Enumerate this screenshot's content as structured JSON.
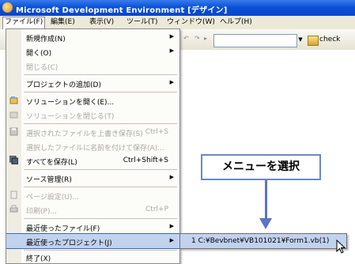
{
  "window": {
    "title": "Microsoft Development Environment [デザイン]"
  },
  "menubar": {
    "items": [
      "ファイル(F)",
      "編集(E)",
      "表示(V)",
      "ツール(T)",
      "ウィンドウ(W)",
      "ヘルプ(H)"
    ]
  },
  "toolbar": {
    "find_text": "check"
  },
  "file_menu": {
    "items": [
      {
        "label": "新規作成(N)",
        "shortcut": "",
        "submenu": true,
        "enabled": true,
        "icon": ""
      },
      {
        "label": "開く(O)",
        "shortcut": "",
        "submenu": true,
        "enabled": true,
        "icon": ""
      },
      {
        "label": "閉じる(C)",
        "shortcut": "",
        "submenu": false,
        "enabled": false,
        "icon": ""
      },
      {
        "label": "プロジェクトの追加(D)",
        "shortcut": "",
        "submenu": true,
        "enabled": true,
        "icon": ""
      },
      {
        "label": "ソリューションを開く(E)...",
        "shortcut": "",
        "submenu": false,
        "enabled": true,
        "icon": "open-solution-icon"
      },
      {
        "label": "ソリューションを閉じる(T)",
        "shortcut": "",
        "submenu": false,
        "enabled": false,
        "icon": "close-solution-icon"
      },
      {
        "label": "選択されたファイルを上書き保存(S)",
        "shortcut": "Ctrl+S",
        "submenu": false,
        "enabled": false,
        "icon": "save-icon"
      },
      {
        "label": "選択したファイルに名前を付けて保存(A)...",
        "shortcut": "",
        "submenu": false,
        "enabled": false,
        "icon": ""
      },
      {
        "label": "すべてを保存(L)",
        "shortcut": "Ctrl+Shift+S",
        "submenu": false,
        "enabled": true,
        "icon": "save-all-icon"
      },
      {
        "label": "ソース管理(R)",
        "shortcut": "",
        "submenu": true,
        "enabled": true,
        "icon": ""
      },
      {
        "label": "ページ設定(U)...",
        "shortcut": "",
        "submenu": false,
        "enabled": false,
        "icon": "page-setup-icon"
      },
      {
        "label": "印刷(P)...",
        "shortcut": "Ctrl+P",
        "submenu": false,
        "enabled": false,
        "icon": "print-icon"
      },
      {
        "label": "最近使ったファイル(F)",
        "shortcut": "",
        "submenu": true,
        "enabled": true,
        "icon": ""
      },
      {
        "label": "最近使ったプロジェクト(J)",
        "shortcut": "",
        "submenu": true,
        "enabled": true,
        "icon": "",
        "highlighted": true
      },
      {
        "label": "終了(X)",
        "shortcut": "",
        "submenu": false,
        "enabled": true,
        "icon": ""
      }
    ]
  },
  "recent_projects_submenu": {
    "items": [
      "1 C:¥Bevbnet¥VB101021¥Form1.vb(1)"
    ]
  },
  "callout": {
    "text": "メニューを選択"
  },
  "colors": {
    "titlebar": "#0a52d8",
    "menu_highlight": "#c1d2ee",
    "callout_border": "#6b87c9",
    "arrow": "#5a75c2"
  }
}
